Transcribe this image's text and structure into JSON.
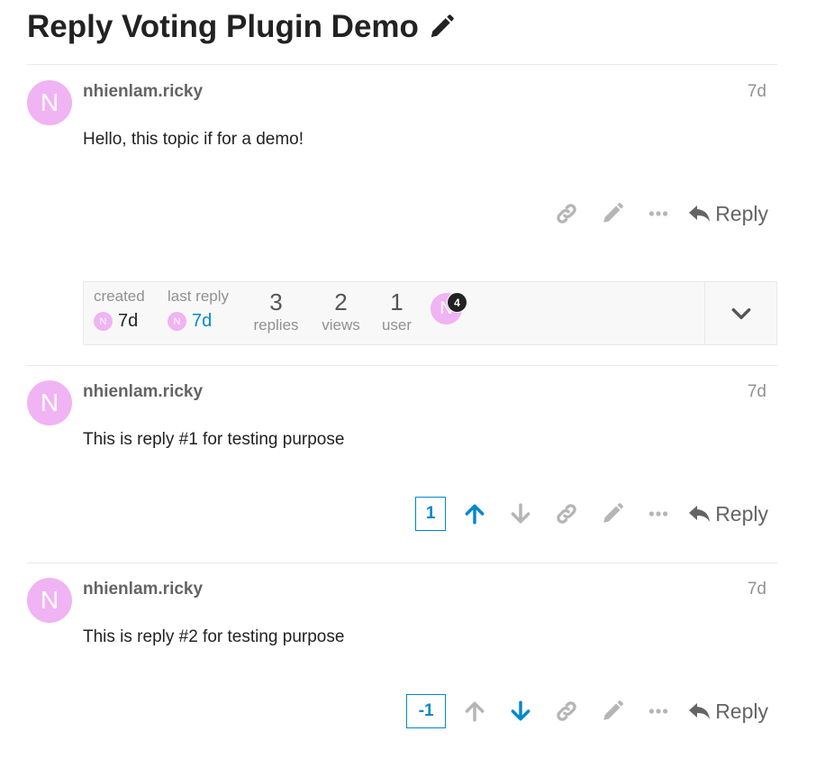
{
  "topic": {
    "title": "Reply Voting Plugin Demo"
  },
  "actions": {
    "reply_label": "Reply"
  },
  "posts": [
    {
      "username": "nhienlam.ricky",
      "avatar_letter": "N",
      "age": "7d",
      "body": "Hello, this topic if for a demo!"
    },
    {
      "username": "nhienlam.ricky",
      "avatar_letter": "N",
      "age": "7d",
      "body": "This is reply #1 for testing purpose",
      "votes": "1",
      "vote_state": "up"
    },
    {
      "username": "nhienlam.ricky",
      "avatar_letter": "N",
      "age": "7d",
      "body": "This is reply #2 for testing purpose",
      "votes": "-1",
      "vote_state": "down"
    }
  ],
  "topic_map": {
    "created_label": "created",
    "created_age": "7d",
    "last_reply_label": "last reply",
    "last_reply_age": "7d",
    "avatar_letter": "N",
    "stats": [
      {
        "value": "3",
        "label": "replies"
      },
      {
        "value": "2",
        "label": "views"
      },
      {
        "value": "1",
        "label": "user"
      }
    ],
    "participant_post_count": "4"
  },
  "colors": {
    "accent": "#0088cc",
    "avatar_bg": "#f0b3f3",
    "muted_icon": "#b5b5b5"
  },
  "icons": [
    "pencil-icon",
    "link-icon",
    "ellipsis-icon",
    "reply-arrow-icon",
    "arrow-up-icon",
    "arrow-down-icon",
    "chevron-down-icon"
  ]
}
